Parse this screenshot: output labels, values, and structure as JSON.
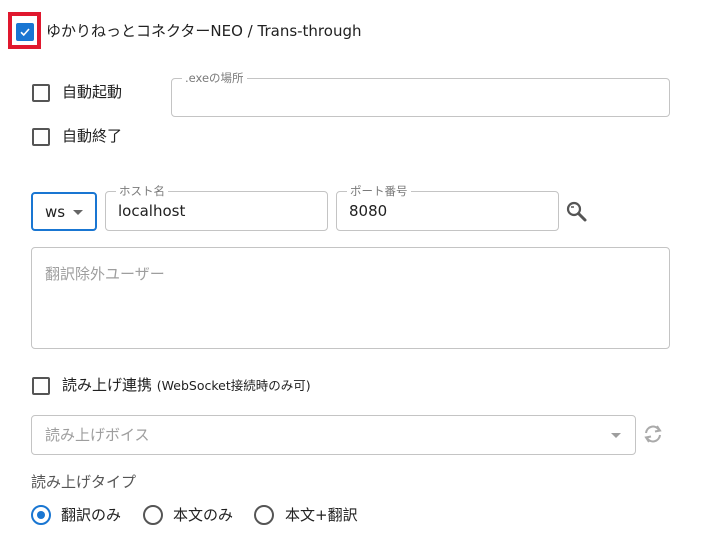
{
  "colors": {
    "accent": "#1976d2",
    "highlight_box": "#e0182e",
    "border": "#c4c4c4",
    "muted": "#9e9e9e"
  },
  "header": {
    "enable_checked": true,
    "title": "ゆかりねっとコネクターNEO / Trans-through"
  },
  "options": {
    "auto_start_label": "自動起動",
    "auto_start_checked": false,
    "auto_exit_label": "自動終了",
    "auto_exit_checked": false,
    "exe_path_label": ".exeの場所",
    "exe_path_value": ""
  },
  "connection": {
    "protocol_value": "ws",
    "host_label": "ホスト名",
    "host_value": "localhost",
    "port_label": "ポート番号",
    "port_value": "8080",
    "search_icon": "search-icon"
  },
  "exclusion": {
    "placeholder": "翻訳除外ユーザー"
  },
  "tts": {
    "link_label": "読み上げ連携",
    "link_note": "(WebSocket接続時のみ可)",
    "link_checked": false,
    "voice_placeholder": "読み上げボイス",
    "refresh_icon": "refresh-icon",
    "type_label": "読み上げタイプ",
    "types": [
      {
        "label": "翻訳のみ",
        "selected": true
      },
      {
        "label": "本文のみ",
        "selected": false
      },
      {
        "label": "本文+翻訳",
        "selected": false
      }
    ]
  }
}
